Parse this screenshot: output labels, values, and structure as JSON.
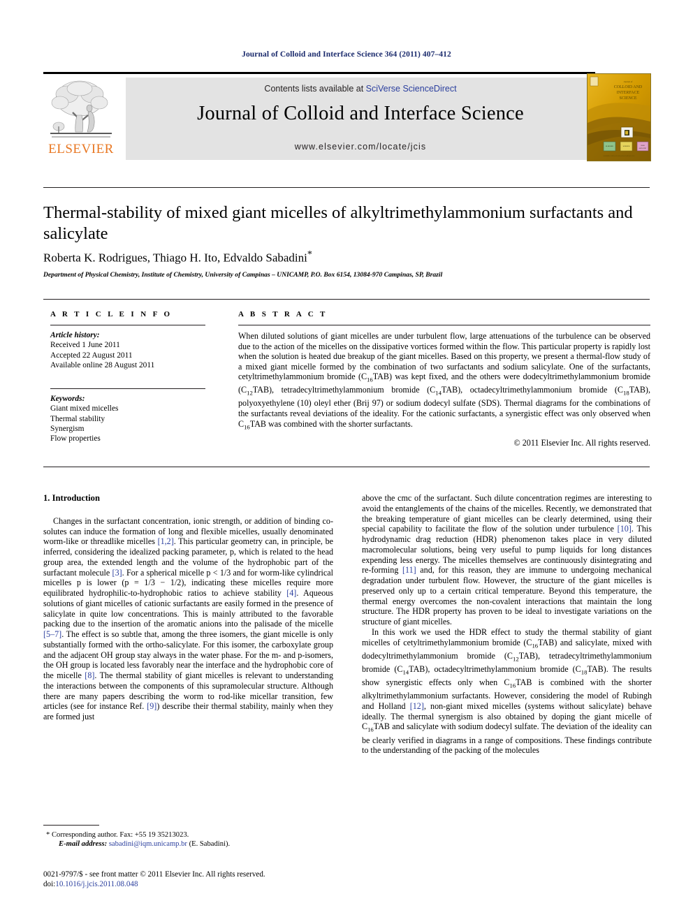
{
  "running_head": "Journal of Colloid and Interface Science 364 (2011) 407–412",
  "masthead": {
    "contents_prefix": "Contents lists available at ",
    "sciencedirect": "SciVerse ScienceDirect",
    "journal_title": "Journal of Colloid and Interface Science",
    "url": "www.elsevier.com/locate/jcis",
    "publisher": "ELSEVIER",
    "cover_lines": [
      "Journal of",
      "COLLOID AND",
      "INTERFACE",
      "SCIENCE"
    ]
  },
  "article": {
    "title": "Thermal-stability of mixed giant micelles of alkyltrimethylammonium surfactants and salicylate",
    "authors": "Roberta K. Rodrigues, Thiago H. Ito, Edvaldo Sabadini",
    "corresponding_marker": "*",
    "affiliation": "Department of Physical Chemistry, Institute of Chemistry, University of Campinas – UNICAMP, P.O. Box 6154, 13084-970 Campinas, SP, Brazil"
  },
  "article_info": {
    "heading": "A R T I C L E   I N F O",
    "history_label": "Article history:",
    "history": [
      "Received 1 June 2011",
      "Accepted 22 August 2011",
      "Available online 28 August 2011"
    ],
    "keywords_label": "Keywords:",
    "keywords": [
      "Giant mixed micelles",
      "Thermal stability",
      "Synergism",
      "Flow properties"
    ]
  },
  "abstract": {
    "heading": "A B S T R A C T",
    "paragraph_1": "When diluted solutions of giant micelles are under turbulent flow, large attenuations of the turbulence can be observed due to the action of the micelles on the dissipative vortices formed within the flow. This particular property is rapidly lost when the solution is heated due breakup of the giant micelles. Based on this property, we present a thermal-flow study of a mixed giant micelle formed by the combination of two surfactants and sodium salicylate. One of the surfactants, cetyltrimethylammonium bromide (C",
    "frag_2": "TAB) was kept fixed, and the others were dodecyltrimethylammonium bromide (C",
    "frag_3": "TAB), tetradecyltrimethylammonium bromide (C",
    "frag_4": "TAB), octadecyltrimethylammonium bromide (C",
    "frag_5": "TAB), polyoxyethylene (10) oleyl ether (Brij 97) or sodium dodecyl sulfate (SDS). Thermal diagrams for the combinations of the surfactants reveal deviations of the ideality. For the cationic surfactants, a synergistic effect was only observed when C",
    "frag_6": "TAB was combined with the shorter surfactants.",
    "sub_16a": "16",
    "sub_12": "12",
    "sub_14": "14",
    "sub_18": "18",
    "sub_16b": "16",
    "rights": "© 2011 Elsevier Inc. All rights reserved."
  },
  "body": {
    "section_heading": "1. Introduction",
    "left_p1_a": "Changes in the surfactant concentration, ionic strength, or addition of binding co-solutes can induce the formation of long and flexible micelles, usually denominated worm-like or threadlike micelles ",
    "left_ref_12": "[1,2]",
    "left_p1_b": ". This particular geometry can, in principle, be inferred, considering the idealized packing parameter, p, which is related to the head group area, the extended length and the volume of the hydrophobic part of the surfactant molecule ",
    "left_ref_3": "[3]",
    "left_p1_c": ". For a spherical micelle p < 1/3 and for worm-like cylindrical micelles p is lower (p = 1/3 − 1/2), indicating these micelles require more equilibrated hydrophilic-to-hydrophobic ratios to achieve stability ",
    "left_ref_4": "[4]",
    "left_p1_d": ". Aqueous solutions of giant micelles of cationic surfactants are easily formed in the presence of salicylate in quite low concentrations. This is mainly attributed to the favorable packing due to the insertion of the aromatic anions into the palisade of the micelle ",
    "left_ref_57": "[5–7]",
    "left_p1_e": ". The effect is so subtle that, among the three isomers, the giant micelle is only substantially formed with the ortho-salicylate. For this isomer, the carboxylate group and the adjacent OH group stay always in the water phase. For the m- and p-isomers, the OH group is located less favorably near the interface and the hydrophobic core of the micelle ",
    "left_ref_8": "[8]",
    "left_p1_f": ". The thermal stability of giant micelles is relevant to understanding the interactions between the components of this supramolecular structure. Although there are many papers describing the worm to rod-like micellar transition, few articles (see for instance Ref. ",
    "left_ref_9": "[9]",
    "left_p1_g": ") describe their thermal stability, mainly when they are formed just",
    "right_p1_a": "above the cmc of the surfactant. Such dilute concentration regimes are interesting to avoid the entanglements of the chains of the micelles. Recently, we demonstrated that the breaking temperature of giant micelles can be clearly determined, using their special capability to facilitate the flow of the solution under turbulence ",
    "right_ref_10": "[10]",
    "right_p1_b": ". This hydrodynamic drag reduction (HDR) phenomenon takes place in very diluted macromolecular solutions, being very useful to pump liquids for long distances expending less energy. The micelles themselves are continuously disintegrating and re-forming ",
    "right_ref_11": "[11]",
    "right_p1_c": " and, for this reason, they are immune to undergoing mechanical degradation under turbulent flow. However, the structure of the giant micelles is preserved only up to a certain critical temperature. Beyond this temperature, the thermal energy overcomes the non-covalent interactions that maintain the long structure. The HDR property has proven to be ideal to investigate variations on the structure of giant micelles.",
    "right_p2_a": "In this work we used the HDR effect to study the thermal stability of giant micelles of cetyltrimethylammonium bromide (C",
    "right_p2_b": "TAB) and salicylate, mixed with dodecyltrimethylammonium bromide (C",
    "right_p2_c": "TAB), tetradecyltrimethylammonium bromide (C",
    "right_p2_d": "TAB), octadecyltrimethylammonium bromide (C",
    "right_p2_e": "TAB). The results show synergistic effects only when C",
    "right_p2_f": "TAB is combined with the shorter alkyltrimethylammonium surfactants. However, considering the model of Rubingh and Holland ",
    "right_ref_12": "[12]",
    "right_p2_g": ", non-giant mixed micelles (systems without salicylate) behave ideally. The thermal synergism is also obtained by doping the giant micelle of C",
    "right_p2_h": "TAB and salicylate with sodium dodecyl sulfate. The deviation of the ideality can be clearly verified in diagrams in a range of compositions. These findings contribute to the understanding of the packing of the molecules",
    "sub16": "16",
    "sub12": "12",
    "sub14": "14",
    "sub18": "18"
  },
  "footer": {
    "corresponding_star": "*",
    "corresponding": "Corresponding author. Fax: +55 19 35213023.",
    "email_label": "E-mail address:",
    "email": "sabadini@iqm.unicamp.br",
    "email_owner": "(E. Sabadini).",
    "issn_line": "0021-9797/$ - see front matter © 2011 Elsevier Inc. All rights reserved.",
    "doi_label": "doi:",
    "doi": "10.1016/j.jcis.2011.08.048"
  },
  "colors": {
    "link_blue": "#2b3f9e",
    "elsevier_orange": "#E87722",
    "banner_gray": "#e3e3e3",
    "cover_gold": "#d9a300"
  }
}
